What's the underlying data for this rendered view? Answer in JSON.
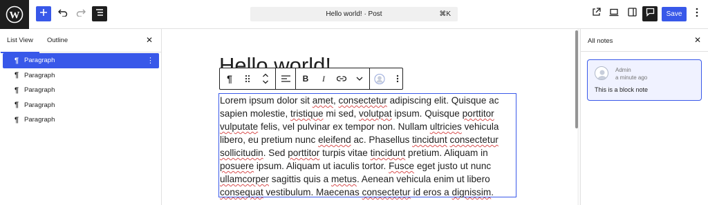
{
  "header": {
    "command_bar_label": "Hello world! · Post",
    "command_shortcut": "⌘K",
    "save_label": "Save"
  },
  "icons": {
    "logo": "wordpress-logo-icon",
    "add": "plus-icon",
    "undo": "undo-icon",
    "redo": "redo-icon",
    "document_overview": "list-icon",
    "view": "external-link-icon",
    "preview": "desktop-icon",
    "settings": "sidebar-icon",
    "notes": "comment-icon",
    "more": "ellipsis-vertical-icon"
  },
  "left_panel": {
    "tabs": [
      {
        "label": "List View"
      },
      {
        "label": "Outline"
      }
    ],
    "close_label": "✕",
    "items": [
      {
        "label": "Paragraph",
        "selected": true
      },
      {
        "label": "Paragraph",
        "selected": false
      },
      {
        "label": "Paragraph",
        "selected": false
      },
      {
        "label": "Paragraph",
        "selected": false
      },
      {
        "label": "Paragraph",
        "selected": false
      }
    ]
  },
  "editor": {
    "title": "Hello world!",
    "paragraph": "Lorem ipsum dolor sit amet, consectetur adipiscing elit. Quisque ac sapien molestie, tristique mi sed, volutpat ipsum. Quisque porttitor vulputate felis, vel pulvinar ex tempor non. Nullam ultricies vehicula libero, eu pretium nunc eleifend ac. Phasellus tincidunt consectetur sollicitudin. Sed porttitor turpis vitae tincidunt pretium. Aliquam in posuere ipsum. Aliquam ut iaculis tortor. Fusce eget justo ut nunc ullamcorper sagittis quis a metus. Aenean vehicula enim ut libero consequat vestibulum. Maecenas consectetur id eros a dignissim."
  },
  "right_panel": {
    "title": "All notes",
    "close_label": "✕",
    "note": {
      "author": "Admin",
      "time": "a minute ago",
      "text": "This is a block note"
    }
  },
  "colors": {
    "accent": "#3858e9",
    "dark": "#1e1e1e"
  }
}
